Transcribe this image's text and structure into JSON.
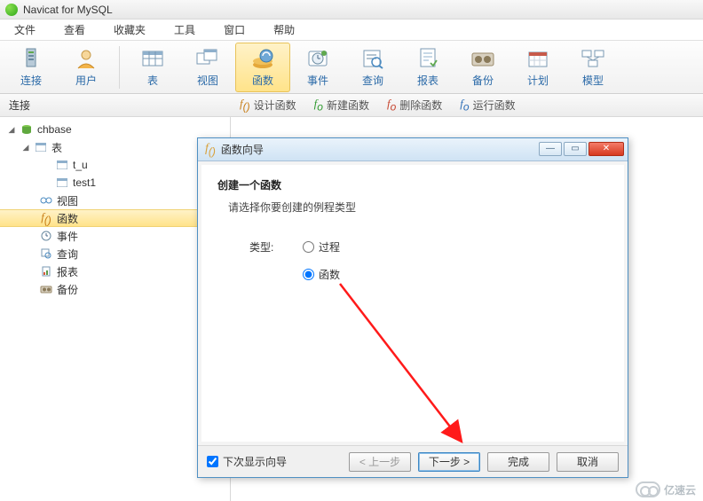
{
  "titlebar": {
    "title": "Navicat for MySQL"
  },
  "menu": [
    "文件",
    "查看",
    "收藏夹",
    "工具",
    "窗口",
    "帮助"
  ],
  "toolbar": {
    "items": [
      {
        "label": "连接"
      },
      {
        "label": "用户"
      },
      {
        "label": "表"
      },
      {
        "label": "视图"
      },
      {
        "label": "函数"
      },
      {
        "label": "事件"
      },
      {
        "label": "查询"
      },
      {
        "label": "报表"
      },
      {
        "label": "备份"
      },
      {
        "label": "计划"
      },
      {
        "label": "模型"
      }
    ]
  },
  "subbar": {
    "label": "连接",
    "actions": [
      {
        "label": "设计函数",
        "color": "#c77d17"
      },
      {
        "label": "新建函数",
        "color": "#2f9a2f"
      },
      {
        "label": "删除函数",
        "color": "#c7452f"
      },
      {
        "label": "运行函数",
        "color": "#2f6fb8"
      }
    ]
  },
  "tree": {
    "db": "chbase",
    "nodes": {
      "tables": "表",
      "t_u": "t_u",
      "test1": "test1",
      "views": "视图",
      "functions": "函数",
      "events": "事件",
      "queries": "查询",
      "reports": "报表",
      "backups": "备份"
    }
  },
  "dialog": {
    "title": "函数向导",
    "heading": "创建一个函数",
    "hint": "请选择你要创建的例程类型",
    "type_label": "类型:",
    "opt_procedure": "过程",
    "opt_function": "函数",
    "show_again": "下次显示向导",
    "btn_prev": "< 上一步",
    "btn_next": "下一步 >",
    "btn_finish": "完成",
    "btn_cancel": "取消"
  },
  "watermark": "亿速云"
}
